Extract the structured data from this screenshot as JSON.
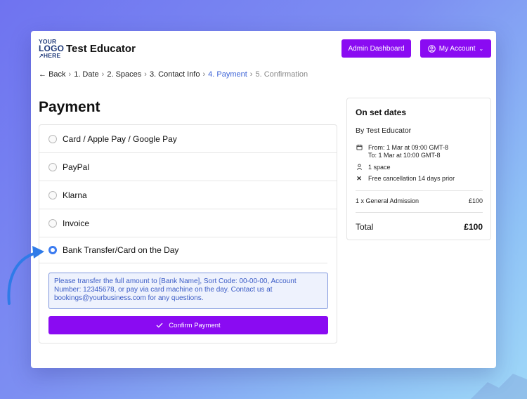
{
  "brand": {
    "logo_line1": "YOUR",
    "logo_line2": "LOGO",
    "logo_line3": "HERE",
    "title": "Test Educator"
  },
  "header": {
    "admin_label": "Admin Dashboard",
    "account_label": "My Account"
  },
  "breadcrumb": {
    "back": "Back",
    "steps": [
      "1. Date",
      "2. Spaces",
      "3. Contact Info",
      "4. Payment",
      "5. Confirmation"
    ],
    "sep": "›"
  },
  "page": {
    "title": "Payment"
  },
  "payment_methods": [
    {
      "label": "Card / Apple Pay / Google Pay",
      "selected": false
    },
    {
      "label": "PayPal",
      "selected": false
    },
    {
      "label": "Klarna",
      "selected": false
    },
    {
      "label": "Invoice",
      "selected": false
    },
    {
      "label": "Bank Transfer/Card on the Day",
      "selected": true
    }
  ],
  "info_text": "Please transfer the full amount to [Bank Name], Sort Code: 00-00-00, Account Number: 12345678, or pay via card machine on the day. Contact us at bookings@yourbusiness.com for any questions.",
  "confirm_label": "Confirm Payment",
  "summary": {
    "title": "On set dates",
    "by": "By Test Educator",
    "from": "From: 1 Mar at 09:00 GMT-8",
    "to": "To: 1 Mar at 10:00 GMT-8",
    "spaces": "1 space",
    "cancellation": "Free cancellation 14 days prior",
    "item_label": "1 x General Admission",
    "item_price": "£100",
    "total_label": "Total",
    "total_value": "£100"
  },
  "colors": {
    "accent": "#8a0bf2",
    "link": "#3b62d6",
    "radio": "#3b7bf0"
  }
}
